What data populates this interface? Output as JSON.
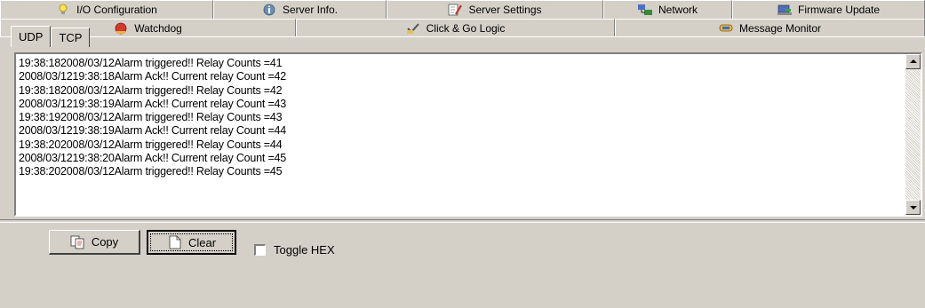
{
  "tabs_row1": [
    {
      "label": "I/O Configuration",
      "icon": "lightbulb-icon"
    },
    {
      "label": "Server Info.",
      "icon": "info-globe-icon"
    },
    {
      "label": "Server Settings",
      "icon": "settings-document-icon"
    },
    {
      "label": "Network",
      "icon": "network-icon"
    },
    {
      "label": "Firmware Update",
      "icon": "firmware-icon"
    }
  ],
  "tabs_row2": [
    {
      "label": "Watchdog",
      "icon": "watchdog-icon"
    },
    {
      "label": "Click & Go Logic",
      "icon": "logic-check-icon"
    },
    {
      "label": "Message Monitor",
      "icon": "message-monitor-icon",
      "active": true
    }
  ],
  "subtabs": [
    {
      "label": "UDP",
      "active": true
    },
    {
      "label": "TCP"
    }
  ],
  "log_lines": [
    "19:38:182008/03/12Alarm triggered!! Relay Counts =41",
    "2008/03/1219:38:18Alarm Ack!! Current relay Count =42",
    "19:38:182008/03/12Alarm triggered!! Relay Counts =42",
    "2008/03/1219:38:19Alarm Ack!! Current relay Count =43",
    "19:38:192008/03/12Alarm triggered!! Relay Counts =43",
    "2008/03/1219:38:19Alarm Ack!! Current relay Count =44",
    "19:38:202008/03/12Alarm triggered!! Relay Counts =44",
    "2008/03/1219:38:20Alarm Ack!! Current relay Count =45",
    "19:38:202008/03/12Alarm triggered!! Relay Counts =45"
  ],
  "buttons": {
    "copy_label": "Copy",
    "clear_label": "Clear"
  },
  "toggle_hex": {
    "label": "Toggle HEX",
    "checked": false
  }
}
